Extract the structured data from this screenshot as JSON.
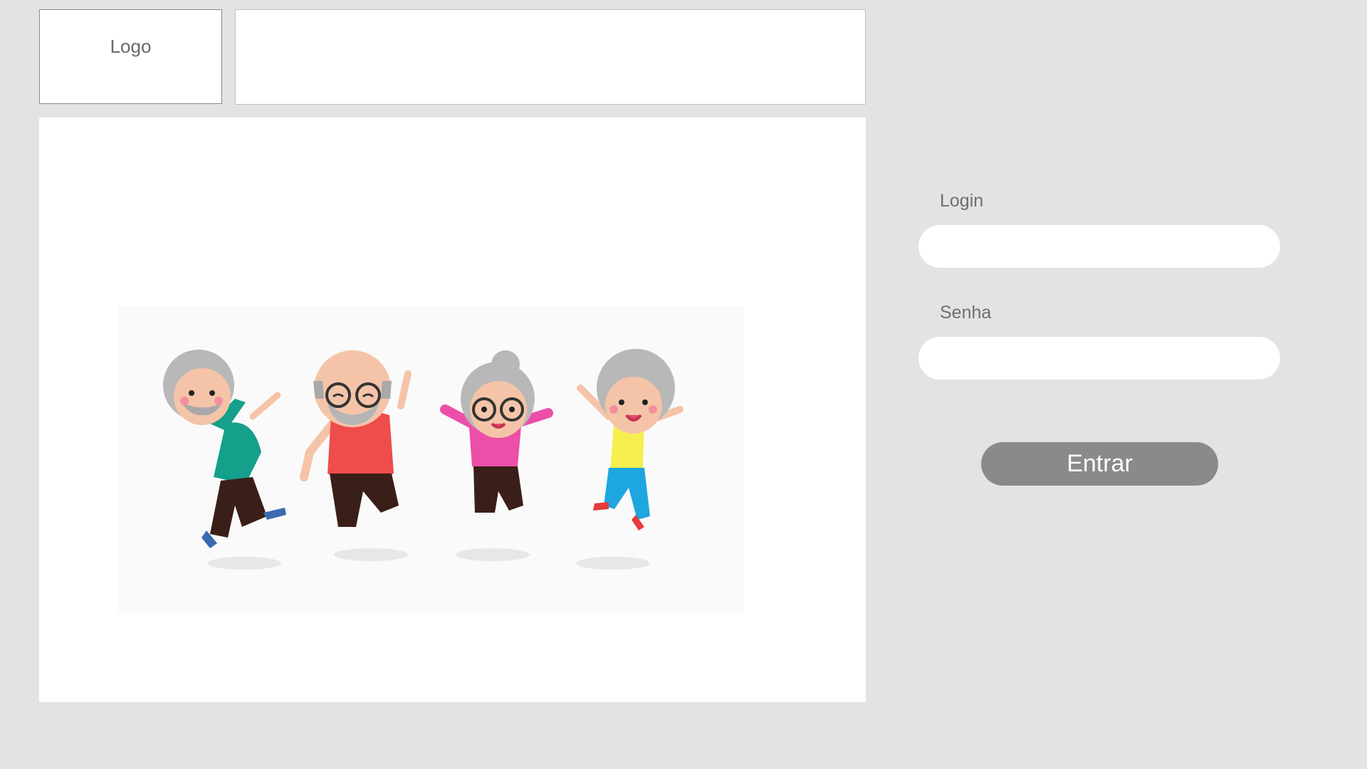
{
  "header": {
    "logo_text": "Logo"
  },
  "hero": {
    "illustration_icon": "jumping-elderly-people-illustration"
  },
  "login_form": {
    "login_label": "Login",
    "login_value": "",
    "password_label": "Senha",
    "password_value": "",
    "submit_label": "Entrar"
  },
  "colors": {
    "background": "#e3e3e3",
    "panel": "#ffffff",
    "button": "#8a8a8a",
    "label_text": "#6e6e6e"
  }
}
